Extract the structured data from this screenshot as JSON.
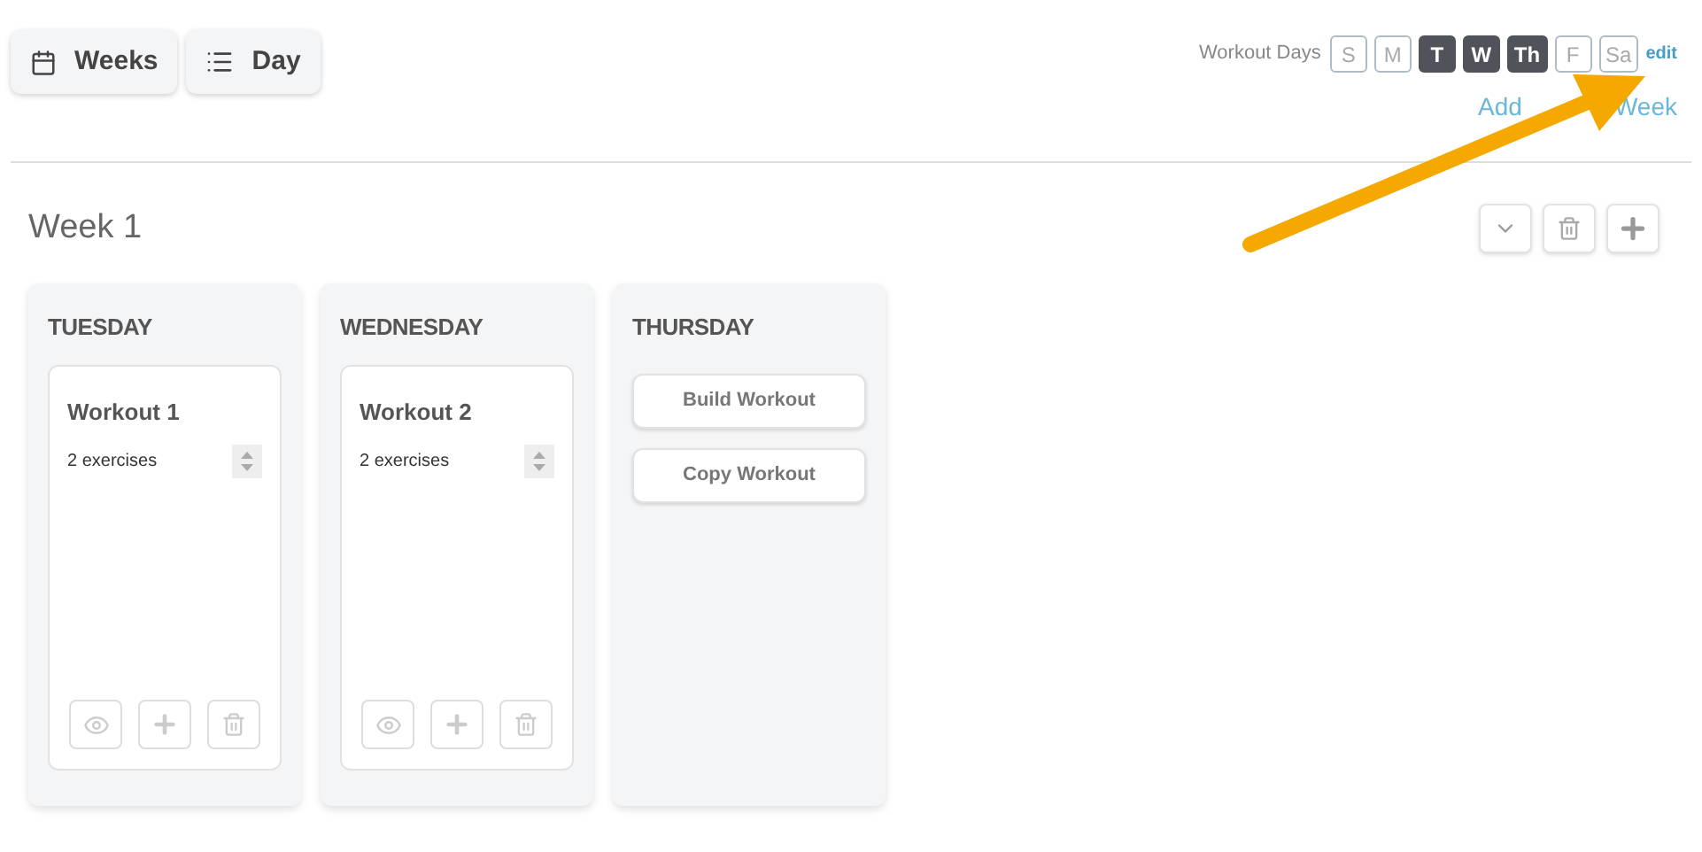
{
  "view_buttons": [
    {
      "kind": "calendar",
      "label": "Weeks"
    },
    {
      "kind": "list",
      "label": "Day"
    }
  ],
  "workout_days": {
    "label": "Workout Days",
    "days": [
      {
        "label": "S",
        "selected": false
      },
      {
        "label": "M",
        "selected": false
      },
      {
        "label": "T",
        "selected": true
      },
      {
        "label": "W",
        "selected": true
      },
      {
        "label": "Th",
        "selected": true
      },
      {
        "label": "F",
        "selected": false
      },
      {
        "label": "Sa",
        "selected": false
      }
    ],
    "edit": "edit"
  },
  "add_week": [
    "Add",
    "Week"
  ],
  "week": {
    "title": "Week 1",
    "columns": [
      {
        "day": "TUESDAY",
        "workouts": [
          {
            "name": "Workout 1",
            "count": "2 exercises"
          }
        ]
      },
      {
        "day": "WEDNESDAY",
        "workouts": [
          {
            "name": "Workout 2",
            "count": "2 exercises"
          }
        ]
      },
      {
        "day": "THURSDAY",
        "actions": [
          "Build Workout",
          "Copy Workout"
        ]
      }
    ]
  }
}
